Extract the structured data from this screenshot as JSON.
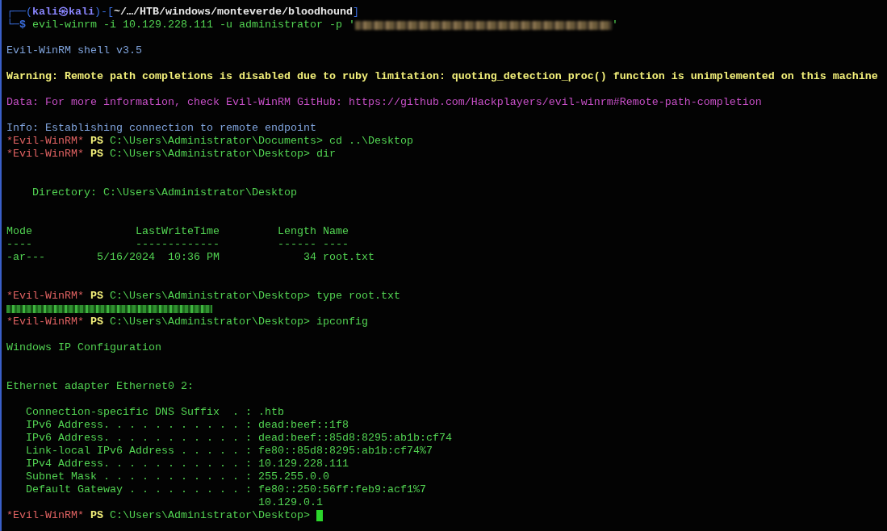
{
  "terminal": {
    "lines": [
      {
        "kind": "text",
        "segments": [
          {
            "kind": "frame",
            "text": "┌──("
          },
          {
            "kind": "user",
            "text": "kali㉿kali"
          },
          {
            "kind": "frame",
            "text": ")-["
          },
          {
            "kind": "cwd",
            "text": "~/…/HTB/windows/monteverde/bloodhound"
          },
          {
            "kind": "frame",
            "text": "]"
          }
        ]
      },
      {
        "kind": "text",
        "segments": [
          {
            "kind": "frame",
            "text": "└─"
          },
          {
            "kind": "dollar",
            "text": "$"
          },
          {
            "kind": "command",
            "text": " evil-winrm -i 10.129.228.111 -u administrator -p '"
          },
          {
            "kind": "redacted"
          },
          {
            "kind": "command",
            "text": "'"
          }
        ]
      },
      {
        "kind": "blank"
      },
      {
        "kind": "text",
        "segments": [
          {
            "kind": "info",
            "text": "Evil-WinRM shell v3.5"
          }
        ]
      },
      {
        "kind": "blank"
      },
      {
        "kind": "text",
        "segments": [
          {
            "kind": "warning",
            "text": "Warning: Remote path completions is disabled due to ruby limitation: quoting_detection_proc() function is unimplemented on this machine"
          }
        ]
      },
      {
        "kind": "blank"
      },
      {
        "kind": "text",
        "segments": [
          {
            "kind": "data",
            "text": "Data: For more information, check Evil-WinRM GitHub: https://github.com/Hackplayers/evil-winrm#Remote-path-completion"
          }
        ]
      },
      {
        "kind": "blank"
      },
      {
        "kind": "text",
        "segments": [
          {
            "kind": "info",
            "text": "Info: Establishing connection to remote endpoint"
          }
        ]
      },
      {
        "kind": "text",
        "segments": [
          {
            "kind": "shell",
            "text": "*Evil-WinRM*"
          },
          {
            "kind": "ps",
            "text": " PS"
          },
          {
            "kind": "command",
            "text": " C:\\Users\\Administrator\\Documents> cd ..\\Desktop"
          }
        ]
      },
      {
        "kind": "text",
        "segments": [
          {
            "kind": "shell",
            "text": "*Evil-WinRM*"
          },
          {
            "kind": "ps",
            "text": " PS"
          },
          {
            "kind": "command",
            "text": " C:\\Users\\Administrator\\Desktop> dir"
          }
        ]
      },
      {
        "kind": "blank"
      },
      {
        "kind": "blank"
      },
      {
        "kind": "text",
        "segments": [
          {
            "kind": "output",
            "text": "    Directory: C:\\Users\\Administrator\\Desktop"
          }
        ]
      },
      {
        "kind": "blank"
      },
      {
        "kind": "blank"
      },
      {
        "kind": "text",
        "segments": [
          {
            "kind": "output",
            "text": "Mode                LastWriteTime         Length Name"
          }
        ]
      },
      {
        "kind": "text",
        "segments": [
          {
            "kind": "output",
            "text": "----                -------------         ------ ----"
          }
        ]
      },
      {
        "kind": "text",
        "segments": [
          {
            "kind": "output",
            "text": "-ar---        5/16/2024  10:36 PM             34 root.txt"
          }
        ]
      },
      {
        "kind": "blank"
      },
      {
        "kind": "blank"
      },
      {
        "kind": "text",
        "segments": [
          {
            "kind": "shell",
            "text": "*Evil-WinRM*"
          },
          {
            "kind": "ps",
            "text": " PS"
          },
          {
            "kind": "command",
            "text": " C:\\Users\\Administrator\\Desktop> type root.txt"
          }
        ]
      },
      {
        "kind": "text",
        "segments": [
          {
            "kind": "redacted-flag"
          }
        ]
      },
      {
        "kind": "text",
        "segments": [
          {
            "kind": "shell",
            "text": "*Evil-WinRM*"
          },
          {
            "kind": "ps",
            "text": " PS"
          },
          {
            "kind": "command",
            "text": " C:\\Users\\Administrator\\Desktop> ipconfig"
          }
        ]
      },
      {
        "kind": "blank"
      },
      {
        "kind": "text",
        "segments": [
          {
            "kind": "output",
            "text": "Windows IP Configuration"
          }
        ]
      },
      {
        "kind": "blank"
      },
      {
        "kind": "blank"
      },
      {
        "kind": "text",
        "segments": [
          {
            "kind": "output",
            "text": "Ethernet adapter Ethernet0 2:"
          }
        ]
      },
      {
        "kind": "blank"
      },
      {
        "kind": "text",
        "segments": [
          {
            "kind": "output",
            "text": "   Connection-specific DNS Suffix  . : .htb"
          }
        ]
      },
      {
        "kind": "text",
        "segments": [
          {
            "kind": "output",
            "text": "   IPv6 Address. . . . . . . . . . . : dead:beef::1f8"
          }
        ]
      },
      {
        "kind": "text",
        "segments": [
          {
            "kind": "output",
            "text": "   IPv6 Address. . . . . . . . . . . : dead:beef::85d8:8295:ab1b:cf74"
          }
        ]
      },
      {
        "kind": "text",
        "segments": [
          {
            "kind": "output",
            "text": "   Link-local IPv6 Address . . . . . : fe80::85d8:8295:ab1b:cf74%7"
          }
        ]
      },
      {
        "kind": "text",
        "segments": [
          {
            "kind": "output",
            "text": "   IPv4 Address. . . . . . . . . . . : 10.129.228.111"
          }
        ]
      },
      {
        "kind": "text",
        "segments": [
          {
            "kind": "output",
            "text": "   Subnet Mask . . . . . . . . . . . : 255.255.0.0"
          }
        ]
      },
      {
        "kind": "text",
        "segments": [
          {
            "kind": "output",
            "text": "   Default Gateway . . . . . . . . . : fe80::250:56ff:feb9:acf1%7"
          }
        ]
      },
      {
        "kind": "text",
        "segments": [
          {
            "kind": "output",
            "text": "                                       10.129.0.1"
          }
        ]
      },
      {
        "kind": "text",
        "segments": [
          {
            "kind": "shell",
            "text": "*Evil-WinRM*"
          },
          {
            "kind": "ps",
            "text": " PS"
          },
          {
            "kind": "command",
            "text": " C:\\Users\\Administrator\\Desktop> "
          },
          {
            "kind": "cursor"
          }
        ]
      }
    ]
  }
}
